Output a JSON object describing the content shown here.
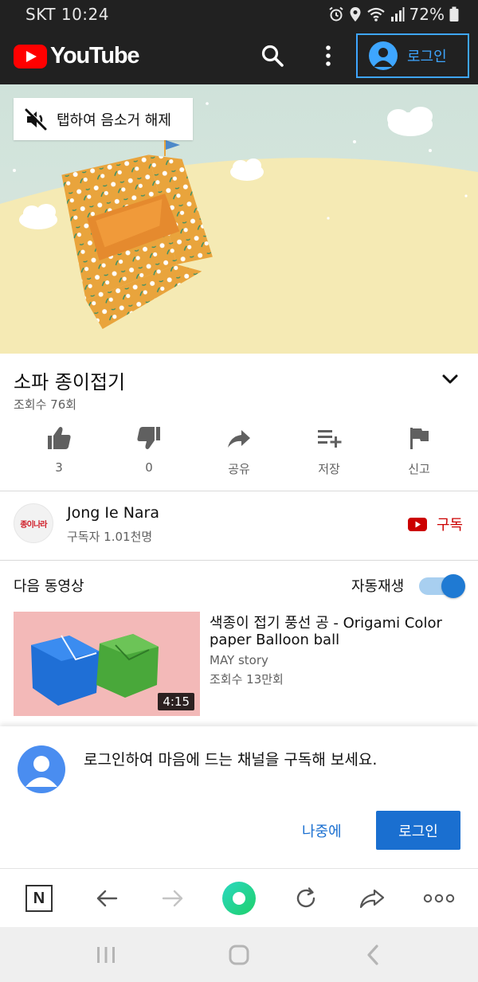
{
  "status_bar": {
    "carrier": "SKT",
    "time": "10:24",
    "battery": "72%",
    "icons": [
      "alarm-icon",
      "location-icon",
      "wifi-icon",
      "signal-icon",
      "battery-icon"
    ]
  },
  "header": {
    "logo_text": "YouTube",
    "icons": [
      "search-icon",
      "more-vert-icon"
    ],
    "login_label": "로그인",
    "accent": "#3ea6ff",
    "brand_red": "#ff0000"
  },
  "video": {
    "unmute_label": "탭하여 음소거 해제",
    "unmute_icon": "volume-off-icon"
  },
  "info": {
    "title": "소파 종이접기",
    "views": "조회수 76회"
  },
  "actions": [
    {
      "icon": "thumb-up-icon",
      "label": "3"
    },
    {
      "icon": "thumb-down-icon",
      "label": "0"
    },
    {
      "icon": "share-icon",
      "label": "공유"
    },
    {
      "icon": "playlist-add-icon",
      "label": "저장"
    },
    {
      "icon": "flag-icon",
      "label": "신고"
    }
  ],
  "channel": {
    "avatar_text": "종이나라",
    "name": "Jong Ie Nara",
    "subscribers": "구독자 1.01천명",
    "subscribe_label": "구독",
    "subscribe_color": "#cc0000"
  },
  "up_next": {
    "heading": "다음 동영상",
    "autoplay_label": "자동재생",
    "autoplay_on": true,
    "video": {
      "title_line1": "색종이 접기 풍선 공 - Origami Color",
      "title_line2": "paper Balloon ball",
      "channel": "MAY story",
      "views": "조회수 13만회",
      "duration": "4:15"
    }
  },
  "signin_prompt": {
    "message": "로그인하여 마음에 드는 채널을 구독해 보세요.",
    "later_label": "나중에",
    "login_label": "로그인",
    "button_color": "#1a6fd0"
  },
  "browser_toolbar": {
    "items": [
      "naver-n-icon",
      "back-arrow-icon",
      "forward-arrow-icon",
      "green-dot-icon",
      "reload-icon",
      "share-arrow-icon",
      "more-horiz-icon"
    ],
    "n_label": "N"
  },
  "android_nav": {
    "items": [
      "recent-apps-icon",
      "home-icon",
      "back-icon"
    ]
  }
}
